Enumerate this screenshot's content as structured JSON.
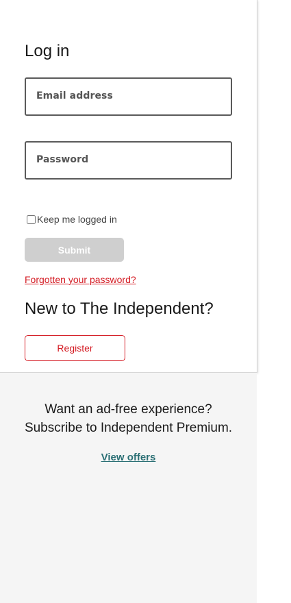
{
  "login": {
    "title": "Log in",
    "email_label": "Email address",
    "password_label": "Password",
    "keep_logged_in_label": "Keep me logged in",
    "keep_logged_in_checked": false,
    "submit_label": "Submit",
    "forgot_password_link": "Forgotten your password?"
  },
  "signup": {
    "title": "New to The Independent?",
    "register_label": "Register"
  },
  "promo": {
    "line1": "Want an ad-free experience?",
    "line2": "Subscribe to Independent Premium.",
    "offers_link": "View offers"
  },
  "colors": {
    "accent_red": "#d41b23",
    "link_teal": "#2a6f74",
    "submit_disabled": "#cfcfcf",
    "promo_background": "#f5f5f5"
  }
}
